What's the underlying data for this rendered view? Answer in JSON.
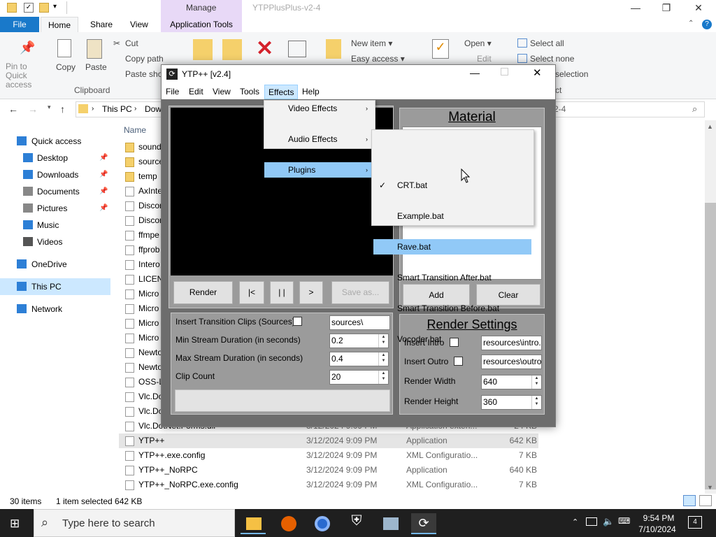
{
  "explorer": {
    "manage_tab": "Manage",
    "window_title": "YTPPlusPlus-v2-4",
    "tabs": [
      "File",
      "Home",
      "Share",
      "View",
      "Application Tools"
    ],
    "ribbon": {
      "pin": "Pin to Quick access",
      "copy": "Copy",
      "paste": "Paste",
      "cut": "Cut",
      "copy_path": "Copy path",
      "paste_shortcut": "Paste shor",
      "clipboard_group": "Clipboard",
      "new_item": "New item",
      "easy_access": "Easy access",
      "open": "Open",
      "edit": "Edit",
      "select_all": "Select all",
      "select_none": "Select none",
      "invert_selection": "selection",
      "select_group": "ct"
    },
    "address": {
      "root": "This PC",
      "next": "Dow",
      "search_tail": "2-4"
    },
    "nav": [
      {
        "label": "Quick access",
        "icon": "star-icon",
        "pinned": false
      },
      {
        "label": "Desktop",
        "icon": "desktop-icon",
        "pinned": true
      },
      {
        "label": "Downloads",
        "icon": "downloads-icon",
        "pinned": true
      },
      {
        "label": "Documents",
        "icon": "documents-icon",
        "pinned": true
      },
      {
        "label": "Pictures",
        "icon": "pictures-icon",
        "pinned": true
      },
      {
        "label": "Music",
        "icon": "music-icon",
        "pinned": false
      },
      {
        "label": "Videos",
        "icon": "videos-icon",
        "pinned": false
      },
      {
        "label": "OneDrive",
        "icon": "onedrive-icon",
        "pinned": false
      },
      {
        "label": "This PC",
        "icon": "thispc-icon",
        "pinned": false
      },
      {
        "label": "Network",
        "icon": "network-icon",
        "pinned": false
      }
    ],
    "name_header": "Name",
    "files": [
      {
        "name": "sound",
        "date": "",
        "type": "",
        "size": ""
      },
      {
        "name": "source",
        "date": "",
        "type": "",
        "size": ""
      },
      {
        "name": "temp",
        "date": "",
        "type": "",
        "size": ""
      },
      {
        "name": "AxInte",
        "date": "",
        "type": "",
        "size": ""
      },
      {
        "name": "Discor",
        "date": "",
        "type": "",
        "size": ""
      },
      {
        "name": "Discor",
        "date": "",
        "type": "",
        "size": ""
      },
      {
        "name": "ffmpe",
        "date": "",
        "type": "",
        "size": ""
      },
      {
        "name": "ffprob",
        "date": "",
        "type": "",
        "size": ""
      },
      {
        "name": "Intero",
        "date": "",
        "type": "",
        "size": ""
      },
      {
        "name": "LICEN",
        "date": "",
        "type": "",
        "size": ""
      },
      {
        "name": "Micro",
        "date": "",
        "type": "",
        "size": ""
      },
      {
        "name": "Micro",
        "date": "",
        "type": "",
        "size": ""
      },
      {
        "name": "Micro",
        "date": "",
        "type": "",
        "size": ""
      },
      {
        "name": "Micro",
        "date": "",
        "type": "",
        "size": ""
      },
      {
        "name": "Newto",
        "date": "",
        "type": "",
        "size": ""
      },
      {
        "name": "Newto",
        "date": "",
        "type": "",
        "size": ""
      },
      {
        "name": "OSS-L",
        "date": "",
        "type": "",
        "size": ""
      },
      {
        "name": "Vlc.Do",
        "date": "",
        "type": "",
        "size": ""
      },
      {
        "name": "Vlc.Do",
        "date": "",
        "type": "",
        "size": ""
      },
      {
        "name": "Vlc.DotNet.Forms.dll",
        "date": "3/12/2024 9:09 PM",
        "type": "Application exten...",
        "size": "24 KB"
      },
      {
        "name": "YTP++",
        "date": "3/12/2024 9:09 PM",
        "type": "Application",
        "size": "642 KB"
      },
      {
        "name": "YTP++.exe.config",
        "date": "3/12/2024 9:09 PM",
        "type": "XML Configuratio...",
        "size": "7 KB"
      },
      {
        "name": "YTP++_NoRPC",
        "date": "3/12/2024 9:09 PM",
        "type": "Application",
        "size": "640 KB"
      },
      {
        "name": "YTP++_NoRPC.exe.config",
        "date": "3/12/2024 9:09 PM",
        "type": "XML Configuratio...",
        "size": "7 KB"
      }
    ],
    "status": {
      "count": "30 items",
      "selected": "1 item selected  642 KB"
    }
  },
  "taskbar": {
    "search_placeholder": "Type here to search",
    "time": "9:54 PM",
    "date": "7/10/2024",
    "notif_count": "4"
  },
  "ytp": {
    "title": "YTP++ [v2.4]",
    "menu": [
      "File",
      "Edit",
      "View",
      "Tools",
      "Effects",
      "Help"
    ],
    "effects_menu": [
      {
        "label": "Video Effects"
      },
      {
        "label": "Audio Effects"
      },
      {
        "label": "Plugins"
      }
    ],
    "plugins": [
      {
        "label": "CRT.bat",
        "checked": true
      },
      {
        "label": "Example.bat",
        "checked": false
      },
      {
        "label": "Rave.bat",
        "checked": false
      },
      {
        "label": "Smart Transition After.bat",
        "checked": false
      },
      {
        "label": "Smart Transition Before.bat",
        "checked": false
      },
      {
        "label": "Vocoder.bat",
        "checked": false
      }
    ],
    "buttons": {
      "render": "Render",
      "first": "|<",
      "pause": "| |",
      "next": ">",
      "save_as": "Save as..."
    },
    "material": {
      "title": "Material",
      "add": "Add",
      "clear": "Clear"
    },
    "settings": {
      "insert_transition_label": "Insert Transition Clips (Sources)",
      "sources_value": "sources\\",
      "min_label": "Min Stream Duration (in seconds)",
      "min_value": "0.2",
      "max_label": "Max Stream Duration (in seconds)",
      "max_value": "0.4",
      "clip_label": "Clip Count",
      "clip_value": "20"
    },
    "render_settings": {
      "title": "Render Settings",
      "intro_label": "Insert Intro",
      "intro_value": "resources\\intro.r",
      "outro_label": "Insert Outro",
      "outro_value": "resources\\outro.",
      "width_label": "Render Width",
      "width_value": "640",
      "height_label": "Render Height",
      "height_value": "360"
    }
  },
  "colors": {
    "accent": "#1979ca",
    "highlight": "#91c9f7",
    "panel": "#9b9b9b",
    "body": "#6d6d6d"
  }
}
